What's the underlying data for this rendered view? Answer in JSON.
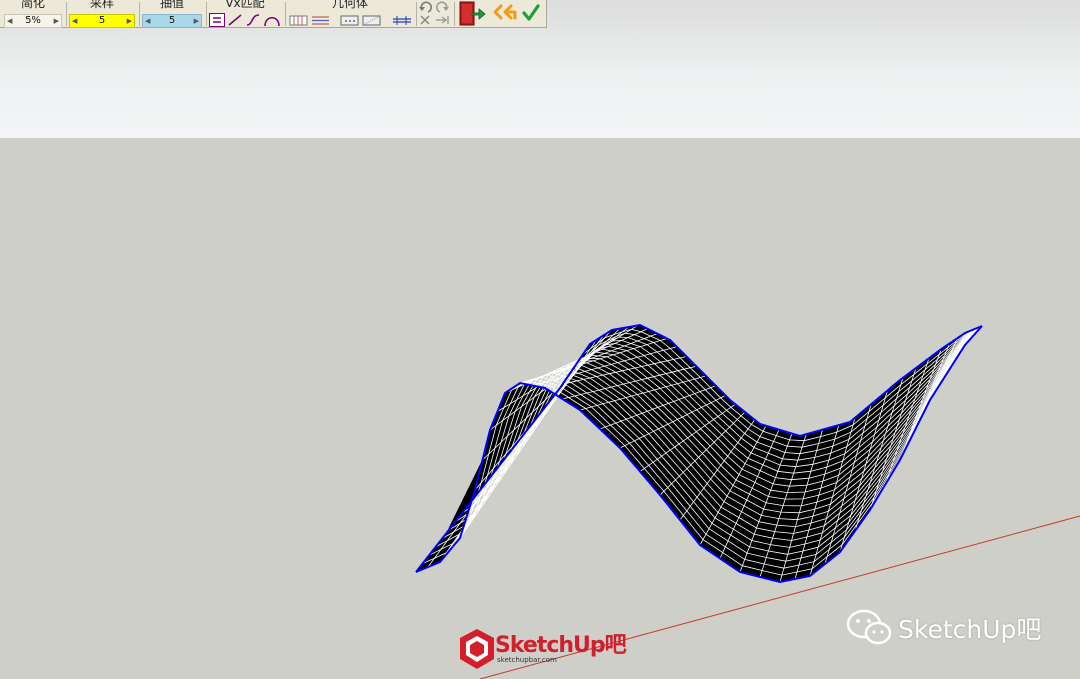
{
  "toolbar": {
    "simplify": {
      "label": "简化",
      "value": "5%"
    },
    "sample": {
      "label": "采样",
      "value": "5"
    },
    "interpolate": {
      "label": "抽值",
      "value": "5"
    },
    "vx_match": {
      "label": "Vx匹配",
      "icons": [
        "list-icon",
        "line-icon",
        "s-curve-icon",
        "arc-icon"
      ]
    },
    "geometry": {
      "label": "几何体",
      "icons": [
        "grid-columns-icon",
        "grid-rows-icon",
        "dotted-rect-icon",
        "dotted-rect-diagonal-icon",
        "cross-lines-icon"
      ]
    },
    "history": {
      "icons": [
        "undo-icon",
        "redo-icon",
        "cancel-icon",
        "skip-icon"
      ]
    },
    "actions": {
      "icons": [
        "exit-door-icon",
        "back-arrow-icon",
        "confirm-check-icon"
      ]
    },
    "colors": {
      "sample_bg": "#ffff00",
      "interpolate_bg": "#a9d8ea",
      "accent": "#800080"
    }
  },
  "viewport": {
    "surface_color": "#000000",
    "wire_color": "#ffffff",
    "edge_color": "#0000ff",
    "axis_color": "#c0392b"
  },
  "watermark": {
    "logo_title": "SketchUp吧",
    "logo_url": "sketchupbar.com",
    "wechat_label": "SketchUp吧"
  }
}
